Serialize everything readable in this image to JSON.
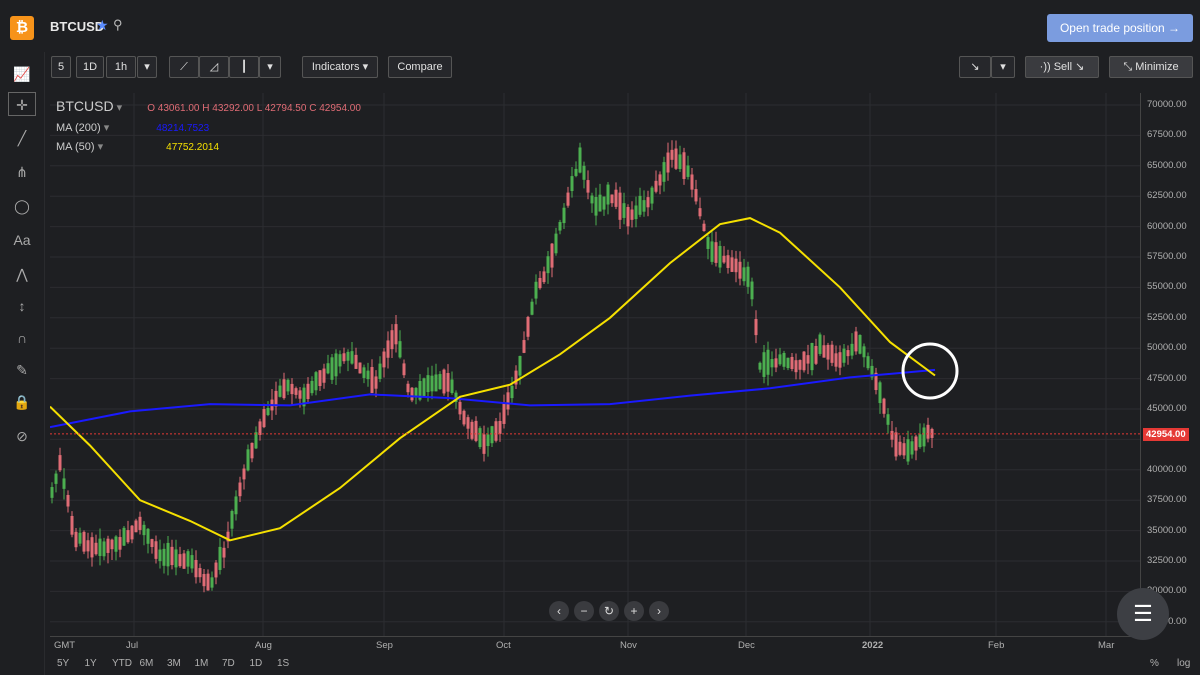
{
  "header": {
    "logo_glyph": "₿",
    "symbol": "BTCUSD",
    "open_trade_label": "Open trade position →"
  },
  "toolbar": {
    "intervals": [
      "5",
      "1D",
      "1h"
    ],
    "indicators_label": "Indicators",
    "compare_label": "Compare",
    "sell_label": "Sell",
    "minimize_label": "Minimize"
  },
  "legend": {
    "symbol": "BTCUSD",
    "ohlc": "O 43061.00  H 43292.00  L 42794.50  C 42954.00",
    "ma200_label": "MA (200)",
    "ma200_value": "48214.7523",
    "ma50_label": "MA (50)",
    "ma50_value": "47752.2014"
  },
  "price_axis": [
    "70000.00",
    "67500.00",
    "65000.00",
    "62500.00",
    "60000.00",
    "57500.00",
    "55000.00",
    "52500.00",
    "50000.00",
    "47500.00",
    "45000.00",
    "42500.00",
    "40000.00",
    "37500.00",
    "35000.00",
    "32500.00",
    "30000.00",
    "27500.00"
  ],
  "last_price": "42954.00",
  "time_axis": [
    "GMT",
    "Jul",
    "Aug",
    "Sep",
    "Oct",
    "Nov",
    "Dec",
    "2022",
    "Feb",
    "Mar"
  ],
  "periods": [
    "5Y",
    "1Y",
    "YTD",
    "6M",
    "3M",
    "1M",
    "7D",
    "1D",
    "1S"
  ],
  "axis_mode": [
    "%",
    "log"
  ],
  "colors": {
    "up": "#4caf50",
    "down": "#e06c75",
    "ma200": "#1a1aff",
    "ma50": "#f5e000",
    "price_line": "#e53935"
  }
}
